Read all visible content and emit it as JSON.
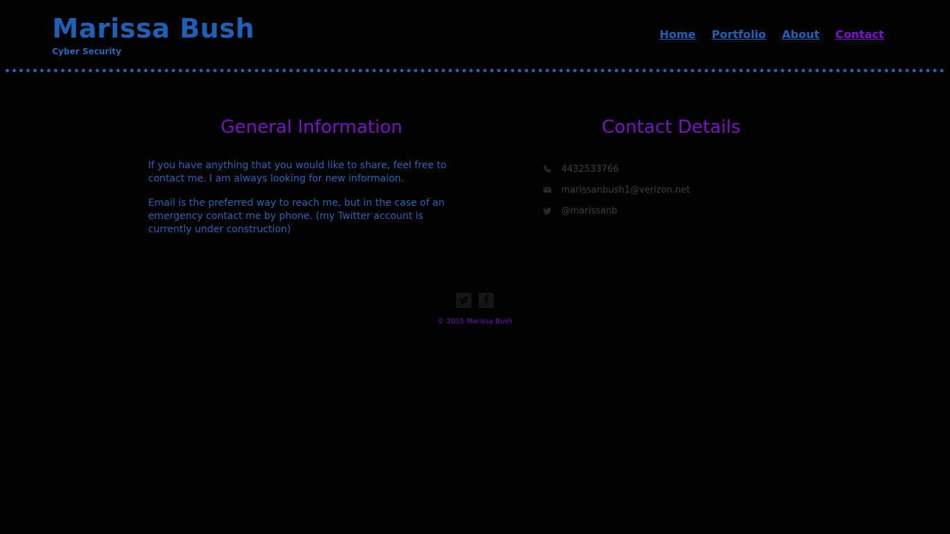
{
  "header": {
    "title": "Marissa Bush",
    "subtitle": "Cyber Security",
    "nav": [
      {
        "label": "Home",
        "active": false
      },
      {
        "label": "Portfolio",
        "active": false
      },
      {
        "label": "About",
        "active": false
      },
      {
        "label": "Contact",
        "active": true
      }
    ]
  },
  "general": {
    "heading": "General Information",
    "paragraphs": [
      "If you have anything that you would like to share, feel free to contact me. I am always looking for new informaion.",
      "Email is the preferred way to reach me, but in the case of an emergency contact me by phone. (my Twitter account is currently under construction)"
    ]
  },
  "contact": {
    "heading": "Contact Details",
    "items": [
      {
        "icon": "phone-icon",
        "text": "4432533766"
      },
      {
        "icon": "mail-icon",
        "text": "marissanbush1@verizon.net"
      },
      {
        "icon": "twitter-icon",
        "text": "@marissanb"
      }
    ]
  },
  "footer": {
    "social": [
      {
        "icon": "twitter-icon"
      },
      {
        "icon": "facebook-icon"
      }
    ],
    "copyright": "© 2015 Marissa Bush"
  },
  "colors": {
    "background": "#020202",
    "brand_blue": "#1f5fb5",
    "accent_purple": "#7714c0",
    "muted_text": "#3e3e3e"
  }
}
